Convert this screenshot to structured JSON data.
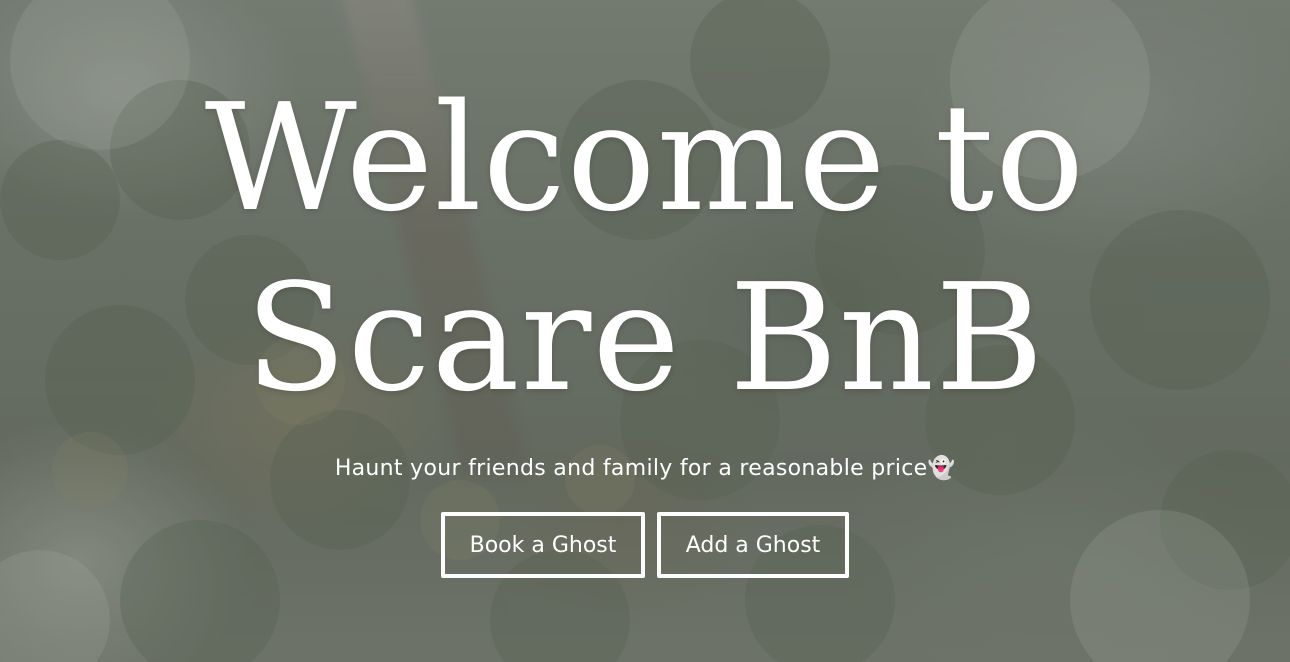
{
  "hero": {
    "title_line_1": "Welcome to",
    "title_line_2": "Scare BnB",
    "subtitle": "Haunt your friends and family for a reasonable price👻",
    "buttons": {
      "book": "Book a Ghost",
      "add": "Add a Ghost"
    },
    "background": "aerial forest video/image with fog",
    "colors": {
      "text": "#ffffff",
      "button_border": "#ffffff"
    }
  }
}
